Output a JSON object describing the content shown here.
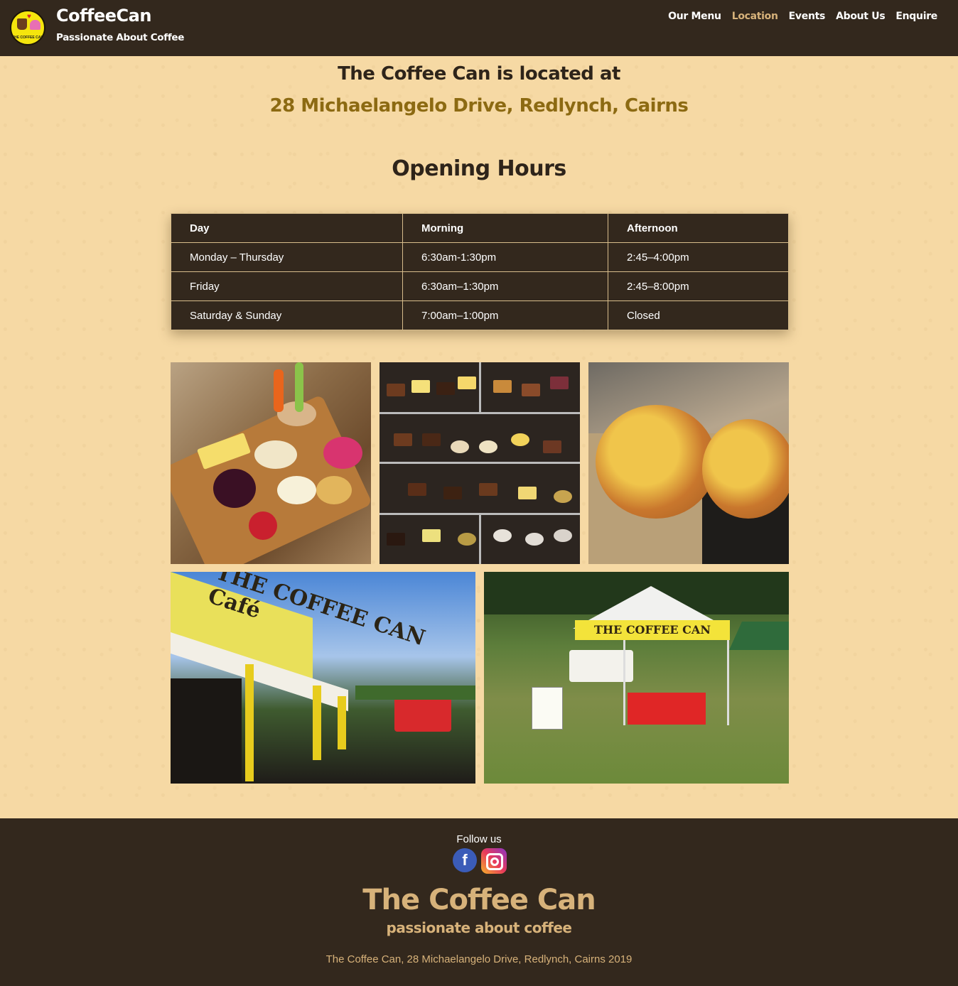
{
  "header": {
    "logo_text": "THE COFFEE CAN",
    "brand_title": "CoffeeCan",
    "brand_subtitle": "Passionate About Coffee",
    "nav": [
      {
        "label": "Our Menu"
      },
      {
        "label": "Location",
        "active": true
      },
      {
        "label": "Events"
      },
      {
        "label": "About Us"
      },
      {
        "label": "Enquire"
      }
    ]
  },
  "location": {
    "heading": "The Coffee Can is located at",
    "address": "28 Michaelangelo Drive, Redlynch, Cairns"
  },
  "hours": {
    "title": "Opening Hours",
    "columns": [
      "Day",
      "Morning",
      "Afternoon"
    ],
    "rows": [
      [
        "Monday – Thursday",
        "6:30am-1:30pm",
        "2:45–4:00pm"
      ],
      [
        "Friday",
        "6:30am–1:30pm",
        "2:45–8:00pm"
      ],
      [
        "Saturday & Sunday",
        "7:00am–1:00pm",
        "Closed"
      ]
    ]
  },
  "gallery": {
    "cafe_sign": "THE COFFEE CAN Café",
    "tent_banner": "THE COFFEE CAN"
  },
  "footer": {
    "follow_label": "Follow us",
    "facebook_glyph": "f",
    "title": "The Coffee Can",
    "subtitle": "passionate about coffee",
    "address_line": "The Coffee Can, 28 Michaelangelo Drive, Redlynch, Cairns 2019"
  },
  "colors": {
    "header_bg": "#33281d",
    "page_bg": "#f6d9a4",
    "accent_gold": "#8c6a12",
    "nav_active": "#d7b27a"
  }
}
